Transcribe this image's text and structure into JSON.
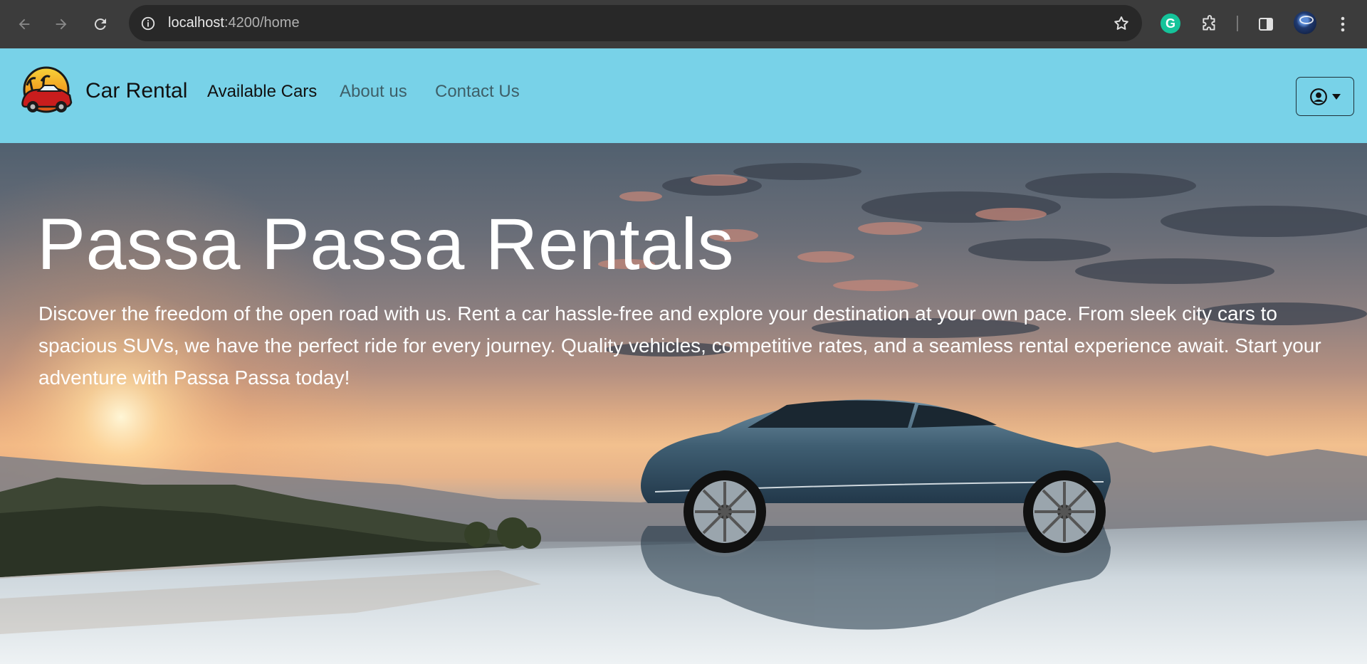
{
  "browser": {
    "url_host": "localhost",
    "url_path": ":4200/home",
    "grammarly_letter": "G"
  },
  "navbar": {
    "brand": "Car Rental",
    "links": [
      {
        "label": "Available Cars",
        "active": true
      },
      {
        "label": "About us",
        "active": false
      },
      {
        "label": "Contact Us",
        "active": false
      }
    ],
    "user_menu_icon": "user-circle-icon",
    "background": "#78d2e8"
  },
  "hero": {
    "title": "Passa Passa Rentals",
    "description": "Discover the freedom of the open road with us. Rent a car hassle-free and explore your destination at your own pace. From sleek city cars to spacious SUVs, we have the perfect ride for every journey. Quality vehicles, competitive rates, and a seamless rental experience await. Start your adventure with Passa Passa today!"
  }
}
